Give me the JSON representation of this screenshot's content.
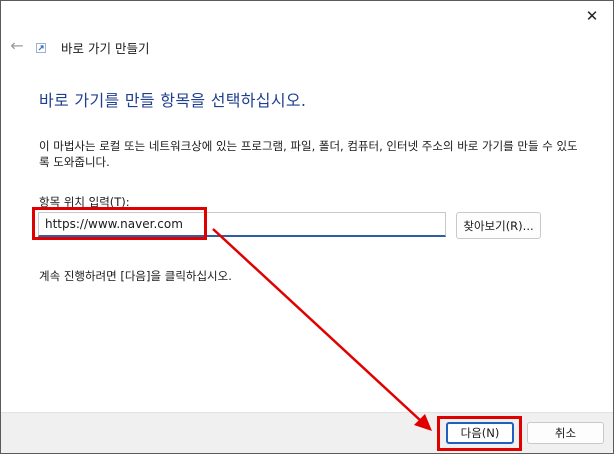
{
  "window": {
    "header_title": "바로 가기 만들기",
    "close_glyph": "✕",
    "back_glyph": "←"
  },
  "main": {
    "heading": "바로 가기를 만들 항목을 선택하십시오.",
    "description": "이 마법사는 로컬 또는 네트워크상에 있는 프로그램, 파일, 폴더, 컴퓨터, 인터넷 주소의 바로 가기를 만들 수 있도록 도와줍니다.",
    "field_label": "항목 위치 입력(T):",
    "location_value": "https://www.naver.com",
    "browse_label": "찾아보기(R)...",
    "instruction": "계속 진행하려면 [다음]을 클릭하십시오."
  },
  "footer": {
    "next_label": "다음(N)",
    "cancel_label": "취소"
  },
  "colors": {
    "heading": "#1f3f8f",
    "annotation": "#e00000",
    "primary_border": "#1f5fbf"
  },
  "icons": [
    "close-icon",
    "back-arrow-icon",
    "shortcut-wizard-icon",
    "annotation-arrow-icon"
  ]
}
